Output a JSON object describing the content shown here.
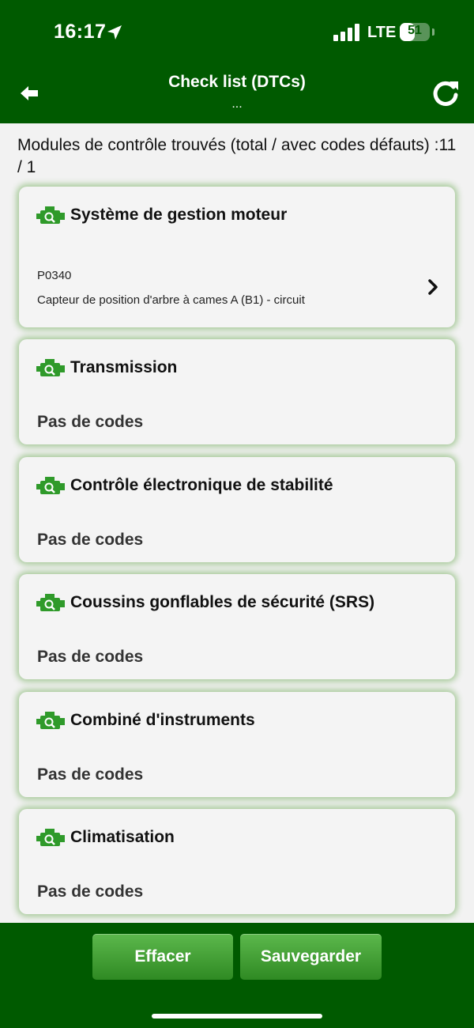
{
  "status_bar": {
    "time": "16:17",
    "network": "LTE",
    "battery_level": "51",
    "battery_fraction": 0.51
  },
  "header": {
    "title": "Check list (DTCs)",
    "subtitle": "...",
    "back_icon": "arrow-left-icon",
    "refresh_icon": "refresh-icon"
  },
  "summary": "Modules de contrôle trouvés (total / avec codes défauts) :11 / 1",
  "modules": [
    {
      "name": "Système de gestion moteur",
      "icon": "engine-icon",
      "dtc_code": "P0340",
      "dtc_description": "Capteur de position d'arbre à cames A (B1) - circuit"
    },
    {
      "name": "Transmission",
      "icon": "engine-icon",
      "status": "Pas de codes"
    },
    {
      "name": "Contrôle électronique de stabilité",
      "icon": "engine-icon",
      "status": "Pas de codes"
    },
    {
      "name": "Coussins gonflables de sécurité (SRS)",
      "icon": "engine-icon",
      "status": "Pas de codes"
    },
    {
      "name": "Combiné d'instruments",
      "icon": "engine-icon",
      "status": "Pas de codes"
    },
    {
      "name": "Climatisation",
      "icon": "engine-icon",
      "status": "Pas de codes"
    }
  ],
  "footer": {
    "clear_label": "Effacer",
    "save_label": "Sauvegarder"
  },
  "colors": {
    "header_bg": "#005a00",
    "accent_green": "#2f9a2a",
    "button_green": "#4aa63c"
  }
}
